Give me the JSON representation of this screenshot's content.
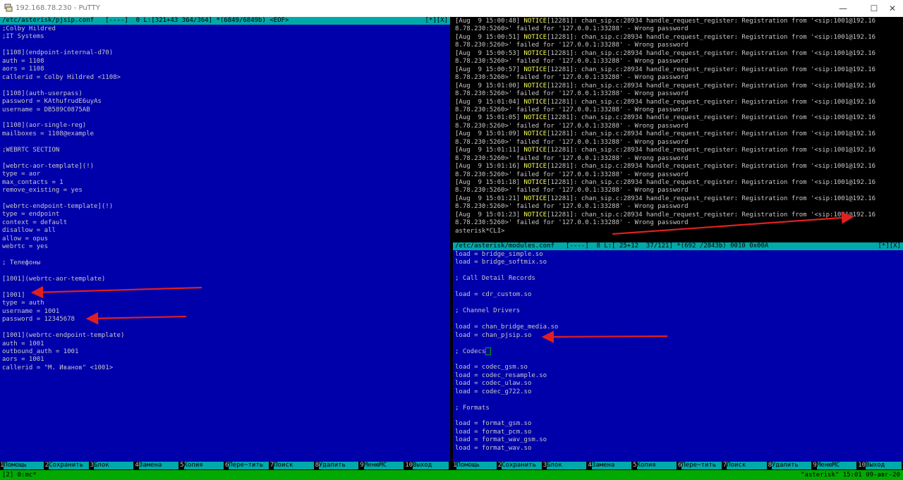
{
  "window": {
    "title": "192.168.78.230 - PuTTY",
    "min": "—",
    "max": "☐",
    "close": "✕"
  },
  "left_pane": {
    "header_left": "/etc/asterisk/pjsip.conf   [----]  0 L:[321+43 364/364] *(6849/6849b) <EOF>",
    "header_right": "[*][X]",
    "lines": [
      ";Colby Hildred",
      ";IT Systems",
      "",
      "[1108](endpoint-internal-d70)",
      "auth = 1108",
      "aors = 1108",
      "callerid = Colby Hildred <1108>",
      "",
      "[1108](auth-userpass)",
      "password = KAthufrudE6uyAs",
      "username = DB589C0875AB",
      "",
      "[1108](aor-single-reg)",
      "mailboxes = 1108@example",
      "",
      ";WEBRTC SECTION",
      "",
      "[webrtc-aor-template](!)",
      "type = aor",
      "max_contacts = 1",
      "remove_existing = yes",
      "",
      "[webrtc-endpoint-template](!)",
      "type = endpoint",
      "context = default",
      "disallow = all",
      "allow = opus",
      "webrtc = yes",
      "",
      "; Телефоны",
      "",
      "[1001](webrtc-aor-template)",
      "",
      "[1001]",
      "type = auth",
      "username = 1001",
      "password = 12345678",
      "",
      "[1001](webrtc-endpoint-template)",
      "auth = 1001",
      "outbound_auth = 1001",
      "aors = 1001",
      "callerid = \"М. Иванов\" <1001>"
    ]
  },
  "console": {
    "entries": [
      {
        "ts": "[Aug  9 15:00:48]"
      },
      {
        "ts": "[Aug  9 15:00:51]"
      },
      {
        "ts": "[Aug  9 15:00:53]"
      },
      {
        "ts": "[Aug  9 15:00:57]"
      },
      {
        "ts": "[Aug  9 15:01:00]"
      },
      {
        "ts": "[Aug  9 15:01:04]"
      },
      {
        "ts": "[Aug  9 15:01:05]"
      },
      {
        "ts": "[Aug  9 15:01:09]"
      },
      {
        "ts": "[Aug  9 15:01:11]"
      },
      {
        "ts": "[Aug  9 15:01:16]"
      },
      {
        "ts": "[Aug  9 15:01:18]"
      },
      {
        "ts": "[Aug  9 15:01:21]"
      },
      {
        "ts": "[Aug  9 15:01:23]"
      }
    ],
    "level": "NOTICE",
    "pid": "[12281]",
    "msg": ": chan_sip.c:28934 handle_request_register: Registration from '<sip:1001@192.16",
    "cont": "8.78.230:5260>' failed for '127.0.0.1:33288' - Wrong password",
    "prompt": "asterisk*CLI>"
  },
  "right_pane": {
    "header_left": "/etc/asterisk/modules.conf   [----]  8 L:[ 25+12  37/121] *(692 /2843b) 0010 0x00A",
    "header_right": "[*][X]",
    "lines": [
      "load = bridge_simple.so",
      "load = bridge_softmix.so",
      "",
      "; Call Detail Records",
      "",
      "load = cdr_custom.so",
      "",
      "; Channel Drivers",
      "",
      "load = chan_bridge_media.so",
      "load = chan_pjsip.so",
      "",
      "; Codecs",
      "",
      "load = codec_gsm.so",
      "load = codec_resample.so",
      "load = codec_ulaw.so",
      "load = codec_g722.so",
      "",
      "; Formats",
      "",
      "load = format_gsm.so",
      "load = format_pcm.so",
      "load = format_wav_gsm.so",
      "load = format_wav.so"
    ]
  },
  "fkeys": [
    {
      "n": "1",
      "label": "Помощь"
    },
    {
      "n": "2",
      "label": "Сохранить"
    },
    {
      "n": "3",
      "label": "Блок"
    },
    {
      "n": "4",
      "label": "Замена"
    },
    {
      "n": "5",
      "label": "Копия"
    },
    {
      "n": "6",
      "label": "Пере~тить"
    },
    {
      "n": "7",
      "label": "Поиск"
    },
    {
      "n": "8",
      "label": "Удалить"
    },
    {
      "n": "9",
      "label": "МенюMC"
    },
    {
      "n": "10",
      "label": "Выход"
    }
  ],
  "status": {
    "left": "[2] 0:mc*",
    "right": "\"asterisk\" 15:01 09-авг-20"
  },
  "colors": {
    "editor_bg": "#0000aa",
    "header_bg": "#00aaaa",
    "status_bg": "#00aa00",
    "notice": "#ffff55",
    "arrow": "#e02020"
  }
}
